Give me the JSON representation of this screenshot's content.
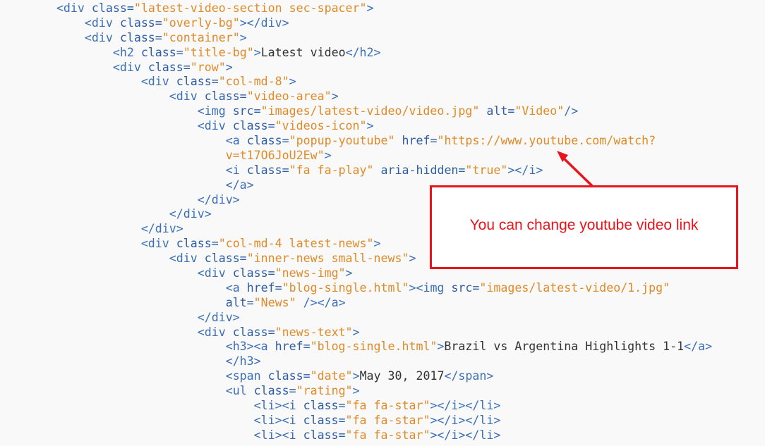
{
  "code_lines": [
    {
      "indent": 2,
      "tokens": [
        {
          "t": "tag",
          "v": "<div "
        },
        {
          "t": "attr",
          "v": "class="
        },
        {
          "t": "val",
          "v": "\"latest-video-section sec-spacer\""
        },
        {
          "t": "tag",
          "v": ">"
        }
      ]
    },
    {
      "indent": 3,
      "tokens": [
        {
          "t": "tag",
          "v": "<div "
        },
        {
          "t": "attr",
          "v": "class="
        },
        {
          "t": "val",
          "v": "\"overly-bg\""
        },
        {
          "t": "tag",
          "v": "></div>"
        }
      ]
    },
    {
      "indent": 3,
      "tokens": [
        {
          "t": "tag",
          "v": "<div "
        },
        {
          "t": "attr",
          "v": "class="
        },
        {
          "t": "val",
          "v": "\"container\""
        },
        {
          "t": "tag",
          "v": ">"
        }
      ]
    },
    {
      "indent": 4,
      "tokens": [
        {
          "t": "tag",
          "v": "<h2 "
        },
        {
          "t": "attr",
          "v": "class="
        },
        {
          "t": "val",
          "v": "\"title-bg\""
        },
        {
          "t": "tag",
          "v": ">"
        },
        {
          "t": "text",
          "v": "Latest video"
        },
        {
          "t": "tag",
          "v": "</h2>"
        }
      ]
    },
    {
      "indent": 4,
      "tokens": [
        {
          "t": "tag",
          "v": "<div "
        },
        {
          "t": "attr",
          "v": "class="
        },
        {
          "t": "val",
          "v": "\"row\""
        },
        {
          "t": "tag",
          "v": ">"
        }
      ]
    },
    {
      "indent": 5,
      "tokens": [
        {
          "t": "tag",
          "v": "<div "
        },
        {
          "t": "attr",
          "v": "class="
        },
        {
          "t": "val",
          "v": "\"col-md-8\""
        },
        {
          "t": "tag",
          "v": ">"
        }
      ]
    },
    {
      "indent": 6,
      "tokens": [
        {
          "t": "tag",
          "v": "<div "
        },
        {
          "t": "attr",
          "v": "class="
        },
        {
          "t": "val",
          "v": "\"video-area\""
        },
        {
          "t": "tag",
          "v": ">"
        }
      ]
    },
    {
      "indent": 7,
      "tokens": [
        {
          "t": "tag",
          "v": "<img "
        },
        {
          "t": "attr",
          "v": "src="
        },
        {
          "t": "val",
          "v": "\"images/latest-video/video.jpg\""
        },
        {
          "t": "plain",
          "v": " "
        },
        {
          "t": "attr",
          "v": "alt="
        },
        {
          "t": "val",
          "v": "\"Video\""
        },
        {
          "t": "tag",
          "v": "/>"
        }
      ]
    },
    {
      "indent": 7,
      "tokens": [
        {
          "t": "tag",
          "v": "<div "
        },
        {
          "t": "attr",
          "v": "class="
        },
        {
          "t": "val",
          "v": "\"videos-icon\""
        },
        {
          "t": "tag",
          "v": ">"
        }
      ]
    },
    {
      "indent": 8,
      "tokens": [
        {
          "t": "tag",
          "v": "<a "
        },
        {
          "t": "attr",
          "v": "class="
        },
        {
          "t": "val",
          "v": "\"popup-youtube\""
        },
        {
          "t": "plain",
          "v": " "
        },
        {
          "t": "attr",
          "v": "href="
        },
        {
          "t": "val",
          "v": "\"https://www.youtube.com/watch?"
        }
      ]
    },
    {
      "indent": 8,
      "tokens": [
        {
          "t": "val",
          "v": "v=t17O6JoU2Ew\""
        },
        {
          "t": "tag",
          "v": ">"
        }
      ]
    },
    {
      "indent": 8,
      "tokens": [
        {
          "t": "tag",
          "v": "<i "
        },
        {
          "t": "attr",
          "v": "class="
        },
        {
          "t": "val",
          "v": "\"fa fa-play\""
        },
        {
          "t": "plain",
          "v": " "
        },
        {
          "t": "attr",
          "v": "aria-hidden="
        },
        {
          "t": "val",
          "v": "\"true\""
        },
        {
          "t": "tag",
          "v": "></i>"
        }
      ]
    },
    {
      "indent": 8,
      "tokens": [
        {
          "t": "tag",
          "v": "</a>"
        }
      ]
    },
    {
      "indent": 7,
      "tokens": [
        {
          "t": "tag",
          "v": "</div>"
        }
      ]
    },
    {
      "indent": 6,
      "tokens": [
        {
          "t": "tag",
          "v": "</div>"
        }
      ]
    },
    {
      "indent": 5,
      "tokens": [
        {
          "t": "tag",
          "v": "</div>"
        }
      ]
    },
    {
      "indent": 5,
      "tokens": [
        {
          "t": "tag",
          "v": "<div "
        },
        {
          "t": "attr",
          "v": "class="
        },
        {
          "t": "val",
          "v": "\"col-md-4 latest-news\""
        },
        {
          "t": "tag",
          "v": ">"
        }
      ]
    },
    {
      "indent": 6,
      "tokens": [
        {
          "t": "tag",
          "v": "<div "
        },
        {
          "t": "attr",
          "v": "class="
        },
        {
          "t": "val",
          "v": "\"inner-news small-news\""
        },
        {
          "t": "tag",
          "v": ">"
        }
      ]
    },
    {
      "indent": 7,
      "tokens": [
        {
          "t": "tag",
          "v": "<div "
        },
        {
          "t": "attr",
          "v": "class="
        },
        {
          "t": "val",
          "v": "\"news-img\""
        },
        {
          "t": "tag",
          "v": ">"
        }
      ]
    },
    {
      "indent": 8,
      "tokens": [
        {
          "t": "tag",
          "v": "<a "
        },
        {
          "t": "attr",
          "v": "href="
        },
        {
          "t": "val",
          "v": "\"blog-single.html\""
        },
        {
          "t": "tag",
          "v": "><img "
        },
        {
          "t": "attr",
          "v": "src="
        },
        {
          "t": "val",
          "v": "\"images/latest-video/1.jpg\""
        }
      ]
    },
    {
      "indent": 8,
      "tokens": [
        {
          "t": "attr",
          "v": "alt="
        },
        {
          "t": "val",
          "v": "\"News\""
        },
        {
          "t": "plain",
          "v": " "
        },
        {
          "t": "tag",
          "v": "/></a>"
        }
      ]
    },
    {
      "indent": 7,
      "tokens": [
        {
          "t": "tag",
          "v": "</div>"
        }
      ]
    },
    {
      "indent": 7,
      "tokens": [
        {
          "t": "tag",
          "v": "<div "
        },
        {
          "t": "attr",
          "v": "class="
        },
        {
          "t": "val",
          "v": "\"news-text\""
        },
        {
          "t": "tag",
          "v": ">"
        }
      ]
    },
    {
      "indent": 8,
      "tokens": [
        {
          "t": "tag",
          "v": "<h3><a "
        },
        {
          "t": "attr",
          "v": "href="
        },
        {
          "t": "val",
          "v": "\"blog-single.html\""
        },
        {
          "t": "tag",
          "v": ">"
        },
        {
          "t": "text",
          "v": "Brazil vs Argentina Highlights 1-1"
        },
        {
          "t": "tag",
          "v": "</a>"
        }
      ]
    },
    {
      "indent": 8,
      "tokens": [
        {
          "t": "tag",
          "v": "</h3>"
        }
      ]
    },
    {
      "indent": 8,
      "tokens": [
        {
          "t": "tag",
          "v": "<span "
        },
        {
          "t": "attr",
          "v": "class="
        },
        {
          "t": "val",
          "v": "\"date\""
        },
        {
          "t": "tag",
          "v": ">"
        },
        {
          "t": "text",
          "v": "May 30, 2017"
        },
        {
          "t": "tag",
          "v": "</span>"
        }
      ]
    },
    {
      "indent": 8,
      "tokens": [
        {
          "t": "tag",
          "v": "<ul "
        },
        {
          "t": "attr",
          "v": "class="
        },
        {
          "t": "val",
          "v": "\"rating\""
        },
        {
          "t": "tag",
          "v": ">"
        }
      ]
    },
    {
      "indent": 9,
      "tokens": [
        {
          "t": "tag",
          "v": "<li><i "
        },
        {
          "t": "attr",
          "v": "class="
        },
        {
          "t": "val",
          "v": "\"fa fa-star\""
        },
        {
          "t": "tag",
          "v": "></i></li>"
        }
      ]
    },
    {
      "indent": 9,
      "tokens": [
        {
          "t": "tag",
          "v": "<li><i "
        },
        {
          "t": "attr",
          "v": "class="
        },
        {
          "t": "val",
          "v": "\"fa fa-star\""
        },
        {
          "t": "tag",
          "v": "></i></li>"
        }
      ]
    },
    {
      "indent": 9,
      "tokens": [
        {
          "t": "tag",
          "v": "<li><i "
        },
        {
          "t": "attr",
          "v": "class="
        },
        {
          "t": "val",
          "v": "\"fa fa-star\""
        },
        {
          "t": "tag",
          "v": "></i></li>"
        }
      ]
    }
  ],
  "annotation": {
    "text": "You can change youtube video link",
    "color": "#e8141b"
  },
  "colors": {
    "background": "#f9f9f9",
    "tag": "#3b6fb5",
    "attribute": "#2d5da3",
    "value": "#e08a28",
    "text": "#333333"
  }
}
